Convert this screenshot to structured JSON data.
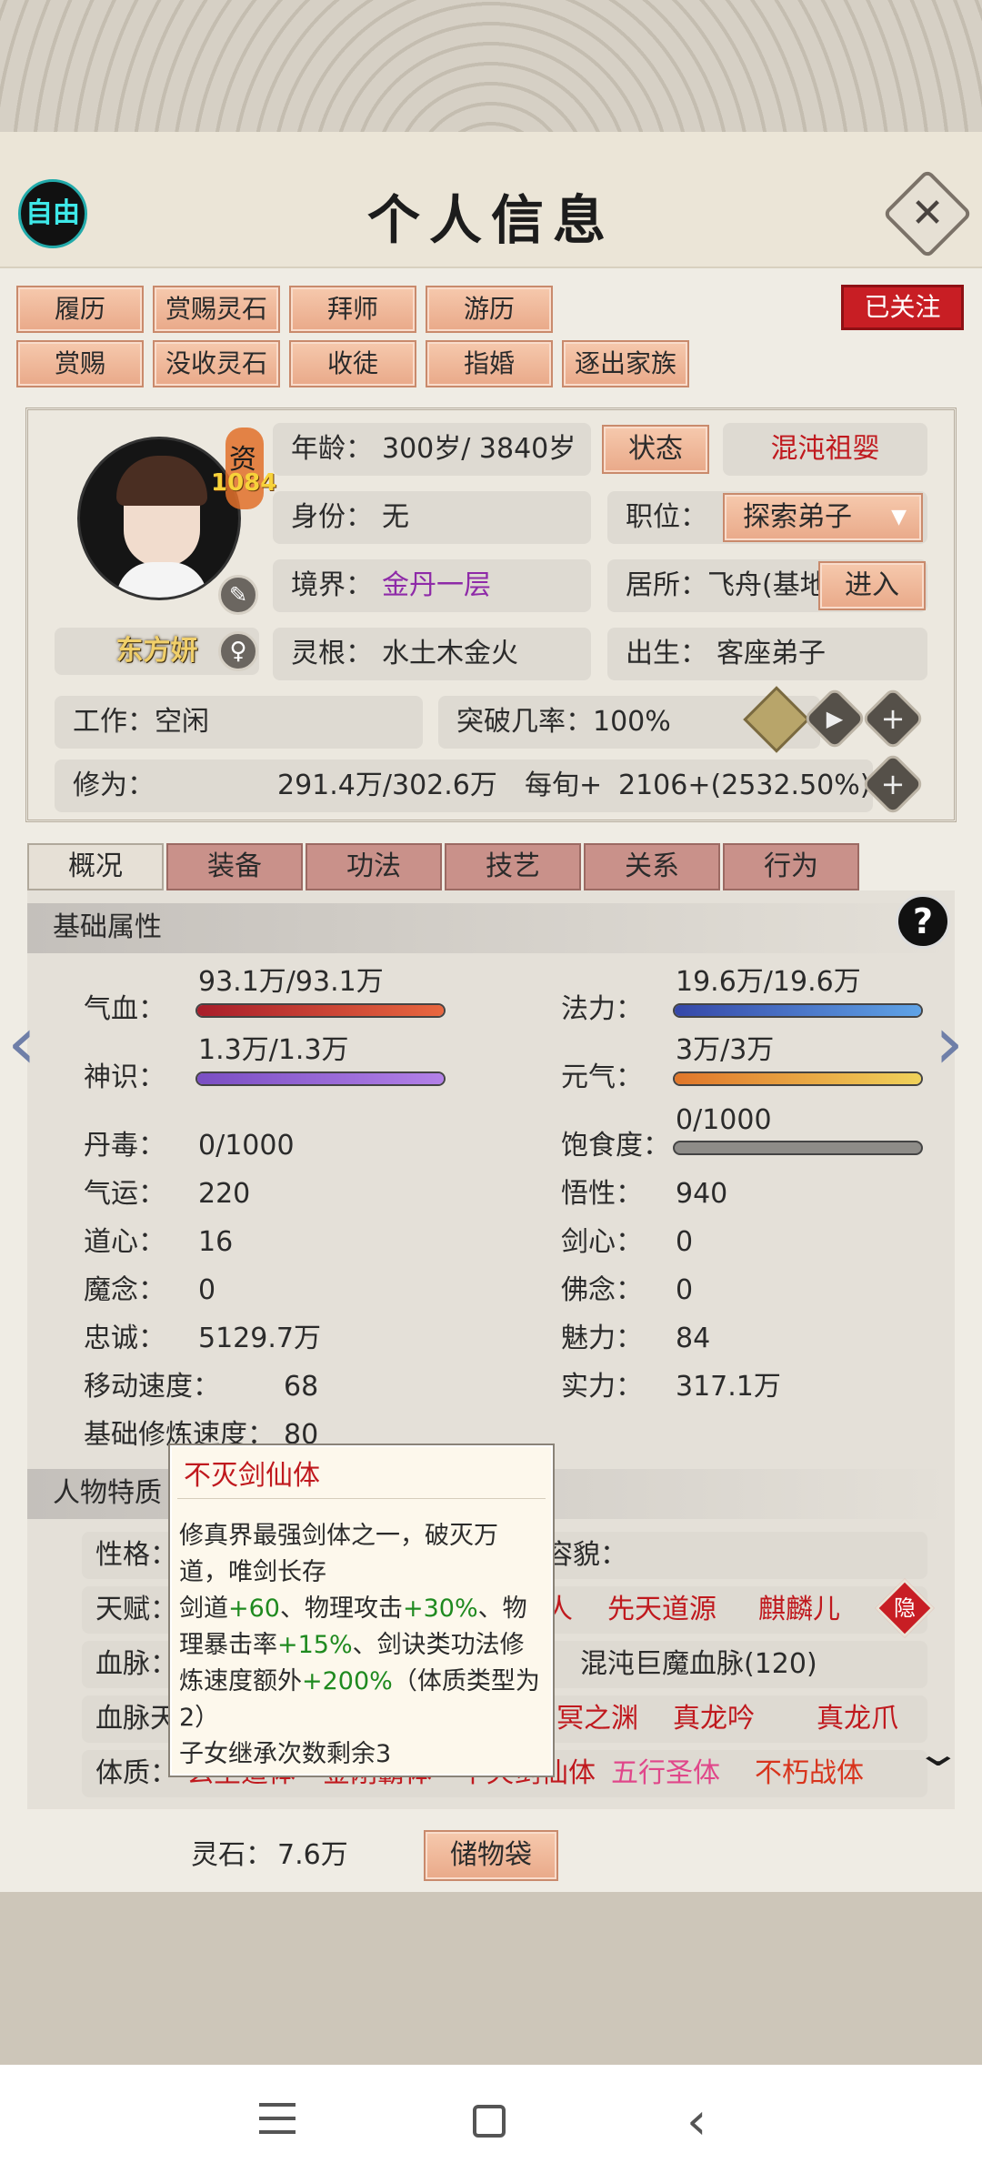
{
  "header": {
    "left_badge": "自由",
    "title": "个人信息",
    "followed": "已关注"
  },
  "actions": {
    "row1": [
      "履历",
      "赏赐灵石",
      "拜师",
      "游历"
    ],
    "row2": [
      "赏赐",
      "没收灵石",
      "收徒",
      "指婚",
      "逐出家族"
    ]
  },
  "profile": {
    "aptitude_label": "资",
    "aptitude_value": "1084",
    "name": "东方妍",
    "age_label": "年龄：",
    "age_value": "300岁/ 3840岁",
    "status_button": "状态",
    "status_value": "混沌祖婴",
    "identity_label": "身份：",
    "identity_value": "无",
    "position_label": "职位：",
    "position_value": "探索弟子",
    "realm_label": "境界：",
    "realm_value": "金丹一层",
    "residence_label": "居所：",
    "residence_value": "飞舟(基地)",
    "enter_button": "进入",
    "root_label": "灵根：",
    "root_value": "水土木金火",
    "birth_label": "出生：",
    "birth_value": "客座弟子",
    "work_label": "工作：",
    "work_value": "空闲",
    "breakthrough_label": "突破几率：",
    "breakthrough_value": "100%",
    "cultivation_label": "修为：",
    "cultivation_value": "291.4万/302.6万",
    "per_turn_label": "每旬+",
    "per_turn_value": "2106+(2532.50%)"
  },
  "tabs": [
    "概况",
    "装备",
    "功法",
    "技艺",
    "关系",
    "行为"
  ],
  "basic": {
    "section_title": "基础属性",
    "hp_label": "气血：",
    "hp_value": "93.1万/93.1万",
    "hp_fill": 1.0,
    "mana_label": "法力：",
    "mana_value": "19.6万/19.6万",
    "mana_fill": 1.0,
    "sense_label": "神识：",
    "sense_value": "1.3万/1.3万",
    "sense_fill": 1.0,
    "vital_label": "元气：",
    "vital_value": "3万/3万",
    "vital_fill": 1.0,
    "satiety_label": "饱食度：",
    "satiety_value": "0/1000",
    "satiety_fill": 0.0,
    "stats": [
      {
        "label": "丹毒：",
        "value": "0/1000"
      },
      {
        "label": "气运：",
        "value": "220"
      },
      {
        "label": "悟性：",
        "value": "940"
      },
      {
        "label": "道心：",
        "value": "16"
      },
      {
        "label": "剑心：",
        "value": "0"
      },
      {
        "label": "魔念：",
        "value": "0"
      },
      {
        "label": "佛念：",
        "value": "0"
      },
      {
        "label": "忠诚：",
        "value": "5129.7万"
      },
      {
        "label": "魅力：",
        "value": "84"
      },
      {
        "label": "移动速度：",
        "value": "68"
      },
      {
        "label": "实力：",
        "value": "317.1万"
      },
      {
        "label": "基础修炼速度：",
        "value": "80"
      }
    ]
  },
  "traits": {
    "section_title": "人物特质",
    "personality_label": "性格：",
    "appearance_label": "容貌：",
    "talent_label": "天赋：",
    "talent_items": [
      "人",
      "先天道源",
      "麒麟儿"
    ],
    "hidden_badge": "隐",
    "bloodline_label": "血脉：",
    "bloodline_value": "混沌巨魔血脉(120)",
    "bloodline_skill_label": "血脉天",
    "bloodline_skills": [
      "冥之渊",
      "真龙吟",
      "真龙爪"
    ],
    "physique_label": "体质：",
    "physique_items": [
      "玄圣道体",
      "金刚霸体",
      "不灭剑仙体",
      "五行圣体",
      "不朽战体"
    ]
  },
  "tooltip": {
    "title": "不灭剑仙体",
    "desc": "修真界最强剑体之一，破灭万道，唯剑长存",
    "effect_parts": [
      {
        "t": "剑道",
        "g": false
      },
      {
        "t": "+60",
        "g": true
      },
      {
        "t": "、物理攻击",
        "g": false
      },
      {
        "t": "+30%",
        "g": true
      },
      {
        "t": "、物理暴击率",
        "g": false
      },
      {
        "t": "+15%",
        "g": true
      },
      {
        "t": "、剑诀类功法修炼速度额外",
        "g": false
      },
      {
        "t": "+200%",
        "g": true
      },
      {
        "t": "（体质类型为2）",
        "g": false
      }
    ],
    "inherit": "子女继承次数剩余3"
  },
  "footer": {
    "spirit_stone_label": "灵石：",
    "spirit_stone_value": "7.6万",
    "bag_button": "储物袋"
  },
  "colors": {
    "red": "#c0191e",
    "purple": "#8e2aa8",
    "green": "#1f8a1f",
    "pink": "#e0468a"
  }
}
